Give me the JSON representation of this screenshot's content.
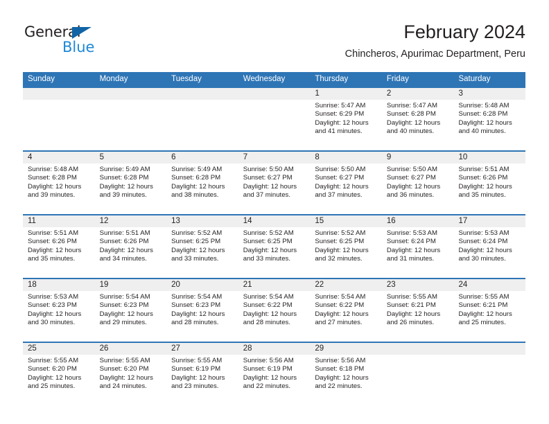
{
  "logo": {
    "word_one": "General",
    "word_two": "Blue",
    "triangle_icon": "triangle-icon",
    "color_dark": "#231f20",
    "color_blue": "#1e87d6",
    "triangle_color": "#1064a6"
  },
  "header": {
    "title": "February 2024",
    "subtitle": "Chincheros, Apurimac Department, Peru"
  },
  "colors": {
    "header_blue": "#2e75b6",
    "daynum_band": "#efefef",
    "text": "#231f20"
  },
  "weekdays": [
    "Sunday",
    "Monday",
    "Tuesday",
    "Wednesday",
    "Thursday",
    "Friday",
    "Saturday"
  ],
  "weeks": [
    [
      {
        "day": "",
        "sunrise": "",
        "sunset": "",
        "daylight1": "",
        "daylight2": ""
      },
      {
        "day": "",
        "sunrise": "",
        "sunset": "",
        "daylight1": "",
        "daylight2": ""
      },
      {
        "day": "",
        "sunrise": "",
        "sunset": "",
        "daylight1": "",
        "daylight2": ""
      },
      {
        "day": "",
        "sunrise": "",
        "sunset": "",
        "daylight1": "",
        "daylight2": ""
      },
      {
        "day": "1",
        "sunrise": "Sunrise: 5:47 AM",
        "sunset": "Sunset: 6:29 PM",
        "daylight1": "Daylight: 12 hours",
        "daylight2": "and 41 minutes."
      },
      {
        "day": "2",
        "sunrise": "Sunrise: 5:47 AM",
        "sunset": "Sunset: 6:28 PM",
        "daylight1": "Daylight: 12 hours",
        "daylight2": "and 40 minutes."
      },
      {
        "day": "3",
        "sunrise": "Sunrise: 5:48 AM",
        "sunset": "Sunset: 6:28 PM",
        "daylight1": "Daylight: 12 hours",
        "daylight2": "and 40 minutes."
      }
    ],
    [
      {
        "day": "4",
        "sunrise": "Sunrise: 5:48 AM",
        "sunset": "Sunset: 6:28 PM",
        "daylight1": "Daylight: 12 hours",
        "daylight2": "and 39 minutes."
      },
      {
        "day": "5",
        "sunrise": "Sunrise: 5:49 AM",
        "sunset": "Sunset: 6:28 PM",
        "daylight1": "Daylight: 12 hours",
        "daylight2": "and 39 minutes."
      },
      {
        "day": "6",
        "sunrise": "Sunrise: 5:49 AM",
        "sunset": "Sunset: 6:28 PM",
        "daylight1": "Daylight: 12 hours",
        "daylight2": "and 38 minutes."
      },
      {
        "day": "7",
        "sunrise": "Sunrise: 5:50 AM",
        "sunset": "Sunset: 6:27 PM",
        "daylight1": "Daylight: 12 hours",
        "daylight2": "and 37 minutes."
      },
      {
        "day": "8",
        "sunrise": "Sunrise: 5:50 AM",
        "sunset": "Sunset: 6:27 PM",
        "daylight1": "Daylight: 12 hours",
        "daylight2": "and 37 minutes."
      },
      {
        "day": "9",
        "sunrise": "Sunrise: 5:50 AM",
        "sunset": "Sunset: 6:27 PM",
        "daylight1": "Daylight: 12 hours",
        "daylight2": "and 36 minutes."
      },
      {
        "day": "10",
        "sunrise": "Sunrise: 5:51 AM",
        "sunset": "Sunset: 6:26 PM",
        "daylight1": "Daylight: 12 hours",
        "daylight2": "and 35 minutes."
      }
    ],
    [
      {
        "day": "11",
        "sunrise": "Sunrise: 5:51 AM",
        "sunset": "Sunset: 6:26 PM",
        "daylight1": "Daylight: 12 hours",
        "daylight2": "and 35 minutes."
      },
      {
        "day": "12",
        "sunrise": "Sunrise: 5:51 AM",
        "sunset": "Sunset: 6:26 PM",
        "daylight1": "Daylight: 12 hours",
        "daylight2": "and 34 minutes."
      },
      {
        "day": "13",
        "sunrise": "Sunrise: 5:52 AM",
        "sunset": "Sunset: 6:25 PM",
        "daylight1": "Daylight: 12 hours",
        "daylight2": "and 33 minutes."
      },
      {
        "day": "14",
        "sunrise": "Sunrise: 5:52 AM",
        "sunset": "Sunset: 6:25 PM",
        "daylight1": "Daylight: 12 hours",
        "daylight2": "and 33 minutes."
      },
      {
        "day": "15",
        "sunrise": "Sunrise: 5:52 AM",
        "sunset": "Sunset: 6:25 PM",
        "daylight1": "Daylight: 12 hours",
        "daylight2": "and 32 minutes."
      },
      {
        "day": "16",
        "sunrise": "Sunrise: 5:53 AM",
        "sunset": "Sunset: 6:24 PM",
        "daylight1": "Daylight: 12 hours",
        "daylight2": "and 31 minutes."
      },
      {
        "day": "17",
        "sunrise": "Sunrise: 5:53 AM",
        "sunset": "Sunset: 6:24 PM",
        "daylight1": "Daylight: 12 hours",
        "daylight2": "and 30 minutes."
      }
    ],
    [
      {
        "day": "18",
        "sunrise": "Sunrise: 5:53 AM",
        "sunset": "Sunset: 6:23 PM",
        "daylight1": "Daylight: 12 hours",
        "daylight2": "and 30 minutes."
      },
      {
        "day": "19",
        "sunrise": "Sunrise: 5:54 AM",
        "sunset": "Sunset: 6:23 PM",
        "daylight1": "Daylight: 12 hours",
        "daylight2": "and 29 minutes."
      },
      {
        "day": "20",
        "sunrise": "Sunrise: 5:54 AM",
        "sunset": "Sunset: 6:23 PM",
        "daylight1": "Daylight: 12 hours",
        "daylight2": "and 28 minutes."
      },
      {
        "day": "21",
        "sunrise": "Sunrise: 5:54 AM",
        "sunset": "Sunset: 6:22 PM",
        "daylight1": "Daylight: 12 hours",
        "daylight2": "and 28 minutes."
      },
      {
        "day": "22",
        "sunrise": "Sunrise: 5:54 AM",
        "sunset": "Sunset: 6:22 PM",
        "daylight1": "Daylight: 12 hours",
        "daylight2": "and 27 minutes."
      },
      {
        "day": "23",
        "sunrise": "Sunrise: 5:55 AM",
        "sunset": "Sunset: 6:21 PM",
        "daylight1": "Daylight: 12 hours",
        "daylight2": "and 26 minutes."
      },
      {
        "day": "24",
        "sunrise": "Sunrise: 5:55 AM",
        "sunset": "Sunset: 6:21 PM",
        "daylight1": "Daylight: 12 hours",
        "daylight2": "and 25 minutes."
      }
    ],
    [
      {
        "day": "25",
        "sunrise": "Sunrise: 5:55 AM",
        "sunset": "Sunset: 6:20 PM",
        "daylight1": "Daylight: 12 hours",
        "daylight2": "and 25 minutes."
      },
      {
        "day": "26",
        "sunrise": "Sunrise: 5:55 AM",
        "sunset": "Sunset: 6:20 PM",
        "daylight1": "Daylight: 12 hours",
        "daylight2": "and 24 minutes."
      },
      {
        "day": "27",
        "sunrise": "Sunrise: 5:55 AM",
        "sunset": "Sunset: 6:19 PM",
        "daylight1": "Daylight: 12 hours",
        "daylight2": "and 23 minutes."
      },
      {
        "day": "28",
        "sunrise": "Sunrise: 5:56 AM",
        "sunset": "Sunset: 6:19 PM",
        "daylight1": "Daylight: 12 hours",
        "daylight2": "and 22 minutes."
      },
      {
        "day": "29",
        "sunrise": "Sunrise: 5:56 AM",
        "sunset": "Sunset: 6:18 PM",
        "daylight1": "Daylight: 12 hours",
        "daylight2": "and 22 minutes."
      },
      {
        "day": "",
        "sunrise": "",
        "sunset": "",
        "daylight1": "",
        "daylight2": ""
      },
      {
        "day": "",
        "sunrise": "",
        "sunset": "",
        "daylight1": "",
        "daylight2": ""
      }
    ]
  ]
}
